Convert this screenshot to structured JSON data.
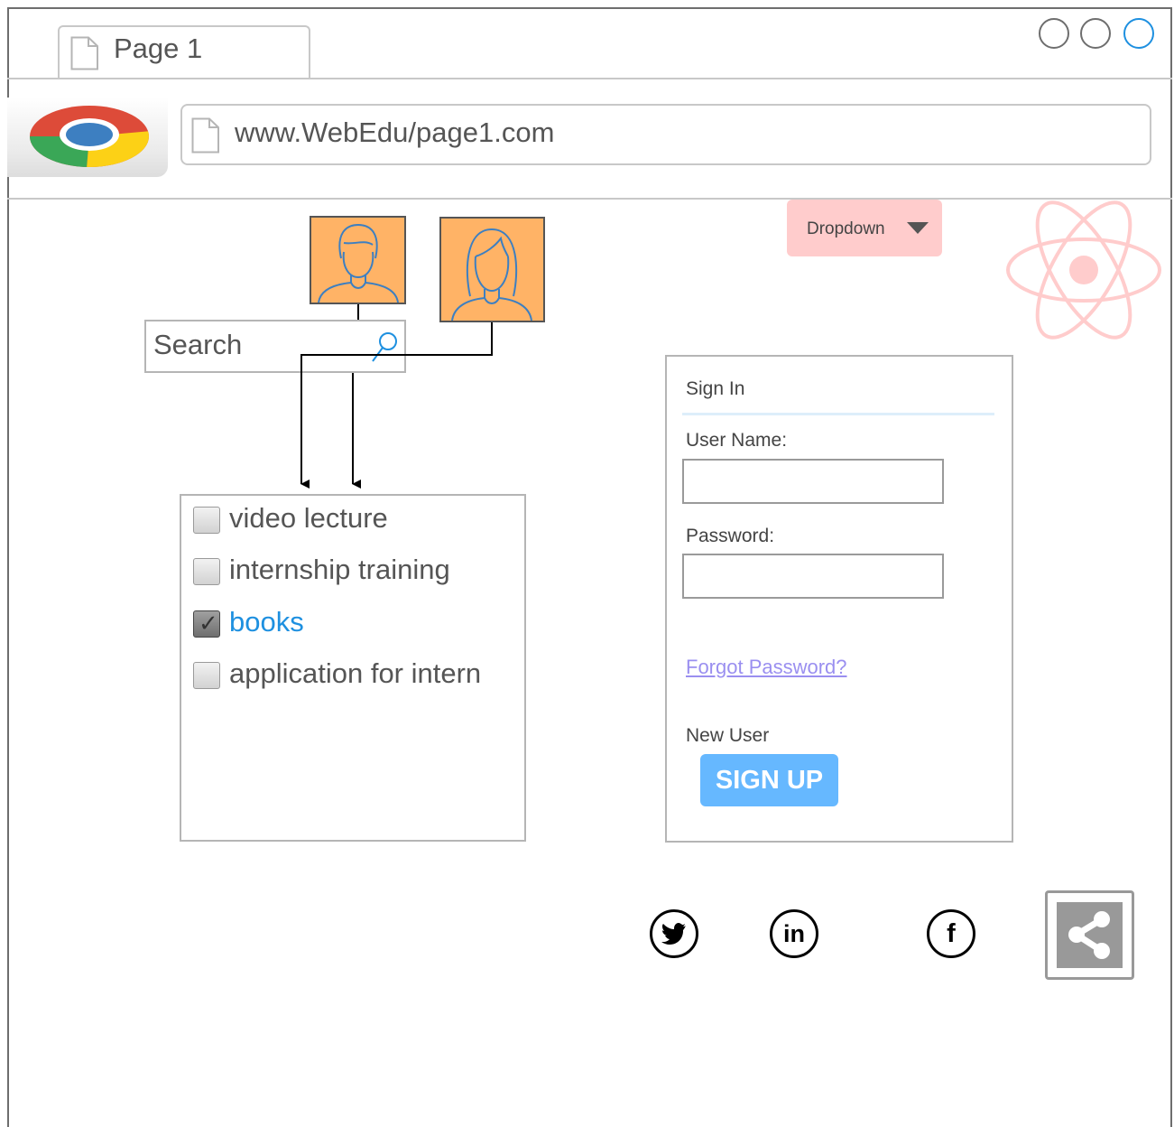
{
  "browser": {
    "tab_label": "Page 1",
    "url": "www.WebEdu/page1.com"
  },
  "search": {
    "placeholder": "Search"
  },
  "checklist": {
    "items": [
      {
        "label": "video lecture",
        "checked": false
      },
      {
        "label": "internship training",
        "checked": false
      },
      {
        "label": "books",
        "checked": true
      },
      {
        "label": "application for intern",
        "checked": false
      }
    ]
  },
  "dropdown": {
    "label": "Dropdown"
  },
  "signin": {
    "title": "Sign In",
    "username_label": "User Name:",
    "password_label": "Password:",
    "forgot_label": "Forgot Password?",
    "new_user_label": "New User",
    "signup_label": "SIGN UP"
  },
  "social": {
    "twitter": "twitter-icon",
    "linkedin": "in",
    "facebook": "f",
    "share": "share-icon"
  },
  "colors": {
    "avatar_fill": "#ffb366",
    "dropdown_bg": "#ffcccc",
    "signup_bg": "#66b8ff",
    "selected_text": "#1e90e0",
    "link": "#9a8ff0",
    "atom": "#ffcccc"
  }
}
